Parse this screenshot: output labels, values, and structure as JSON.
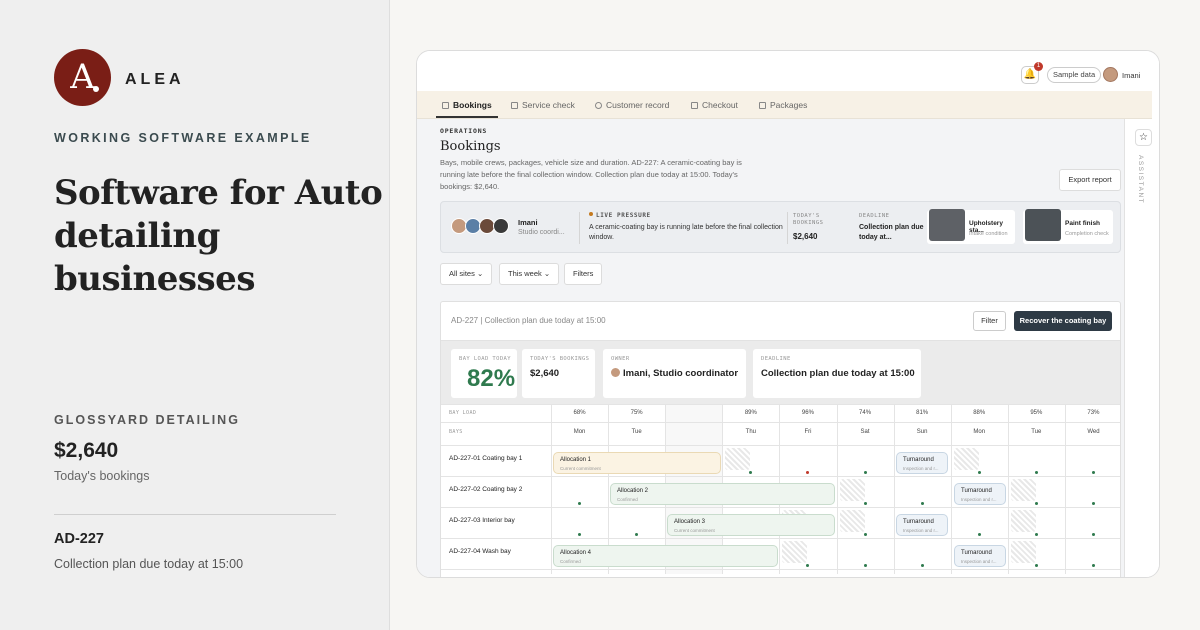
{
  "brand": {
    "logo_letter": "A",
    "name": "ALEA"
  },
  "left": {
    "eyebrow": "WORKING SOFTWARE EXAMPLE",
    "headline": "Software for Auto detailing businesses",
    "business_name": "GLOSSYARD DETAILING",
    "amount": "$2,640",
    "amount_label": "Today's bookings",
    "code": "AD-227",
    "code_detail": "Collection plan due today at 15:00"
  },
  "app": {
    "topbar": {
      "bell_count": "1",
      "sample_label": "Sample data",
      "user_name": "Imani"
    },
    "tabs": [
      {
        "label": "Bookings",
        "icon": "calendar-icon",
        "active": true
      },
      {
        "label": "Service check",
        "icon": "clipboard-icon",
        "active": false
      },
      {
        "label": "Customer record",
        "icon": "person-icon",
        "active": false
      },
      {
        "label": "Checkout",
        "icon": "register-icon",
        "active": false
      },
      {
        "label": "Packages",
        "icon": "box-icon",
        "active": false
      }
    ],
    "assistant": {
      "star": "☆",
      "label": "ASSISTANT"
    },
    "page": {
      "section": "OPERATIONS",
      "title": "Bookings",
      "description": "Bays, mobile crews, packages, vehicle size and duration. AD-227: A ceramic-coating bay is running late before the final collection window. Collection plan due today at 15:00. Today's bookings: $2,640.",
      "export_label": "Export report"
    },
    "pressure": {
      "person_name": "Imani",
      "person_role": "Studio coordi...",
      "live_label": "LIVE PRESSURE",
      "live_text": "A ceramic-coating bay is running late before the final collection window.",
      "bookings_label": "TODAY'S BOOKINGS",
      "bookings_value": "$2,640",
      "deadline_label": "DEADLINE",
      "deadline_value": "Collection plan due today at...",
      "thumbs": [
        {
          "title": "Upholstery sta...",
          "sub": "Intake condition"
        },
        {
          "title": "Paint finish",
          "sub": "Completion check"
        }
      ]
    },
    "filters": {
      "sites": "All sites",
      "week": "This week",
      "filters": "Filters"
    },
    "board": {
      "header": "AD-227 | Collection plan due today at 15:00",
      "filter_label": "Filter",
      "action_label": "Recover the coating bay",
      "kpis": {
        "bay_load_label": "BAY LOAD TODAY",
        "bay_load_value": "82%",
        "bookings_label": "TODAY'S BOOKINGS",
        "bookings_value": "$2,640",
        "owner_label": "OWNER",
        "owner_value": "Imani, Studio coordinator",
        "deadline_label": "DEADLINE",
        "deadline_value": "Collection plan due today at 15:00"
      },
      "bay_load_label": "BAY LOAD",
      "bays_label": "BAYS",
      "loads": [
        "68%",
        "75%",
        "82%",
        "89%",
        "96%",
        "74%",
        "81%",
        "88%",
        "95%",
        "73%"
      ],
      "days": [
        "Mon",
        "Tue",
        "Wed",
        "Thu",
        "Fri",
        "Sat",
        "Sun",
        "Mon",
        "Tue",
        "Wed"
      ],
      "today_marker": "today",
      "rows": [
        "AD-227-01 Coating bay 1",
        "AD-227-02 Coating bay 2",
        "AD-227-03 Interior bay",
        "AD-227-04 Wash bay"
      ],
      "allocations": [
        {
          "title": "Allocation 1",
          "status": "Current commitment"
        },
        {
          "title": "Allocation 2",
          "status": "Confirmed"
        },
        {
          "title": "Allocation 3",
          "status": "Current commitment"
        },
        {
          "title": "Allocation 4",
          "status": "Confirmed"
        }
      ],
      "turnarounds": [
        {
          "title": "Turnaround",
          "status": "Inspection and r..."
        },
        {
          "title": "Turnaround",
          "status": "Inspection and r..."
        },
        {
          "title": "Turnaround",
          "status": "Inspection and r..."
        },
        {
          "title": "Turnaround",
          "status": "Inspection and r..."
        }
      ]
    }
  },
  "colors": {
    "brand": "#7a1e16",
    "primary_button": "#2e3a45",
    "kpi_green": "#2f7a4e",
    "alloc_warm": "#fbf3e3",
    "alloc_green": "#eef5ef",
    "turnaround_blue": "#eef3f8",
    "dot_green": "#2f7a4e",
    "dot_red": "#c0392b"
  }
}
